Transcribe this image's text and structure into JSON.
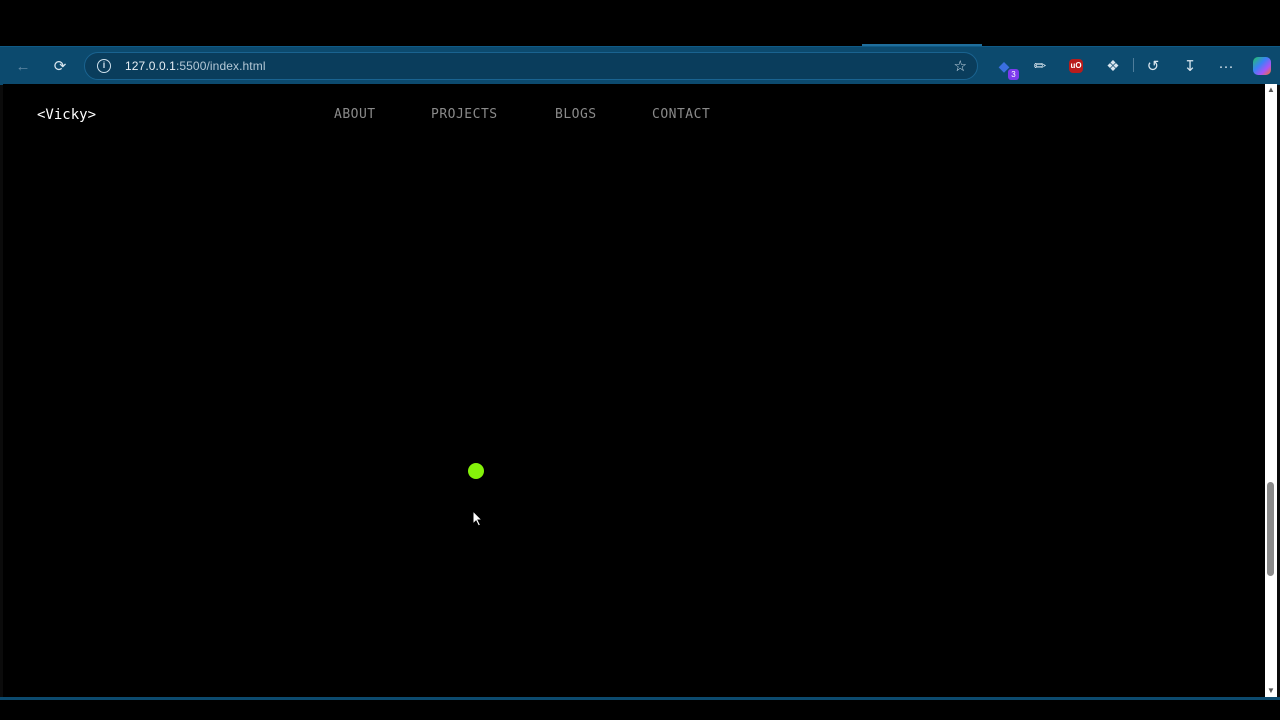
{
  "browser": {
    "url_host": "127.0.0.1",
    "url_path": ":5500/index.html",
    "extension_badge_count": "3",
    "ublock_label": "uO",
    "icons": {
      "back": "arrow-left-icon",
      "reload": "reload-icon",
      "info": "info-icon",
      "favorite": "star-icon",
      "extension1": "extension-cube-icon",
      "eyedropper": "eyedropper-icon",
      "ublock": "ublock-icon",
      "extensions": "puzzle-icon",
      "history": "history-icon",
      "downloads": "download-icon",
      "more": "more-icon",
      "copilot": "copilot-icon"
    }
  },
  "page": {
    "logo": "<Vicky>",
    "nav": [
      {
        "label": "ABOUT"
      },
      {
        "label": "PROJECTS"
      },
      {
        "label": "BLOGS"
      },
      {
        "label": "CONTACT"
      }
    ],
    "colors": {
      "background": "#000000",
      "accent_dot": "#84f20a",
      "nav_text": "#8a8a8a",
      "toolbar": "#0c4a6e"
    }
  }
}
